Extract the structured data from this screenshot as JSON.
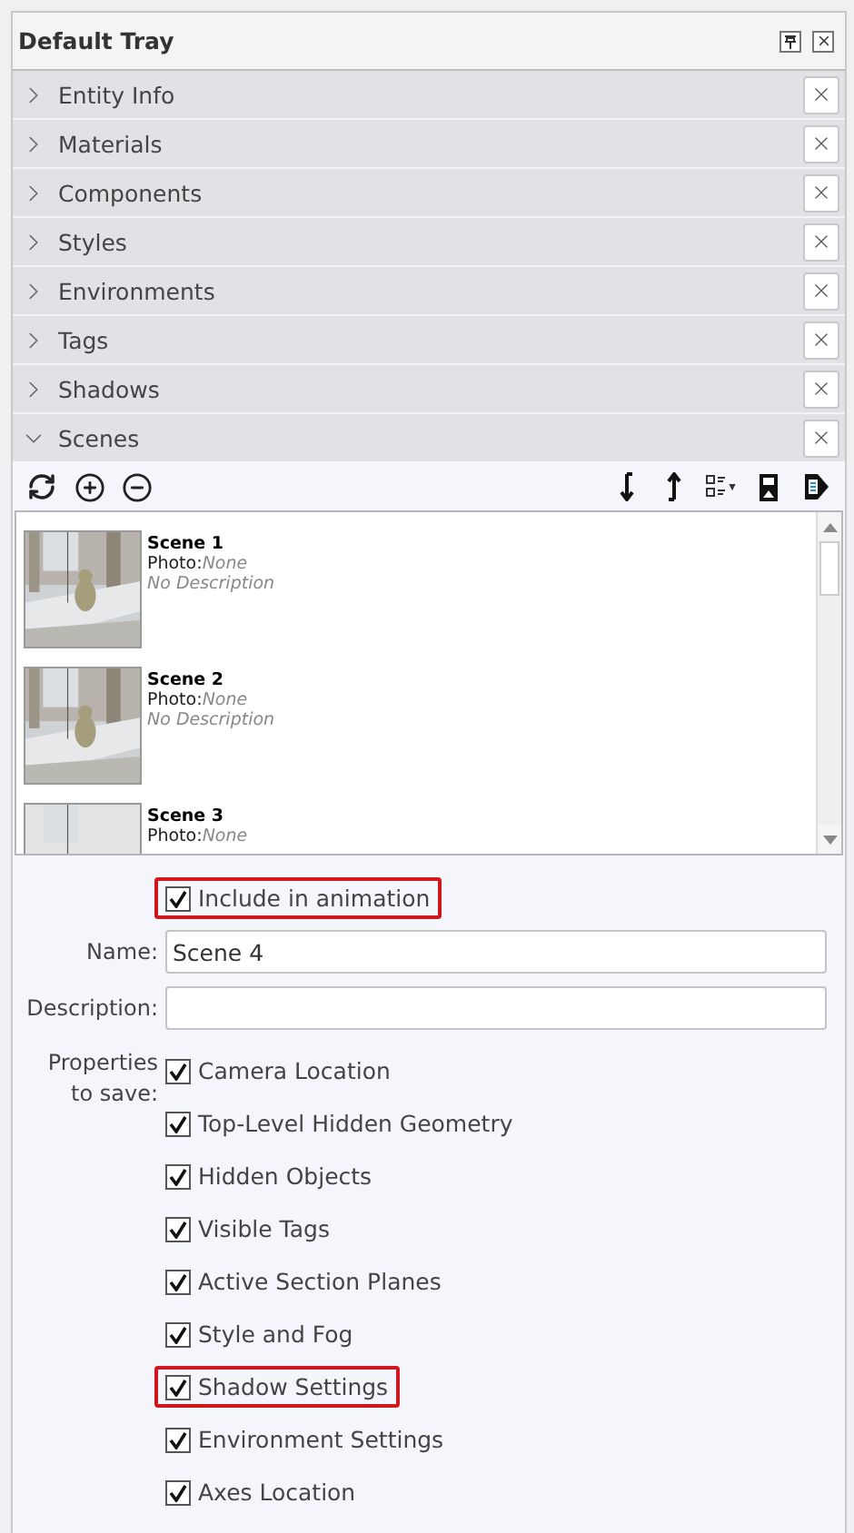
{
  "tray": {
    "title": "Default Tray"
  },
  "panels": [
    {
      "label": "Entity Info",
      "expanded": false
    },
    {
      "label": "Materials",
      "expanded": false
    },
    {
      "label": "Components",
      "expanded": false
    },
    {
      "label": "Styles",
      "expanded": false
    },
    {
      "label": "Environments",
      "expanded": false
    },
    {
      "label": "Tags",
      "expanded": false
    },
    {
      "label": "Shadows",
      "expanded": false
    },
    {
      "label": "Scenes",
      "expanded": true
    }
  ],
  "scenes": [
    {
      "name": "Scene 1",
      "photo_label": "Photo:",
      "photo": "None",
      "description": "No Description"
    },
    {
      "name": "Scene 2",
      "photo_label": "Photo:",
      "photo": "None",
      "description": "No Description"
    },
    {
      "name": "Scene 3",
      "photo_label": "Photo:",
      "photo": "None"
    }
  ],
  "include_animation": {
    "label": "Include in animation",
    "checked": true,
    "highlighted": true
  },
  "name_field": {
    "label": "Name:",
    "value": "Scene 4"
  },
  "description_field": {
    "label": "Description:"
  },
  "properties": {
    "label": "Properties\nto save:",
    "items": [
      {
        "label": "Camera Location",
        "checked": true,
        "highlighted": false
      },
      {
        "label": "Top-Level Hidden Geometry",
        "checked": true,
        "highlighted": false
      },
      {
        "label": "Hidden Objects",
        "checked": true,
        "highlighted": false
      },
      {
        "label": "Visible Tags",
        "checked": true,
        "highlighted": false
      },
      {
        "label": "Active Section Planes",
        "checked": true,
        "highlighted": false
      },
      {
        "label": "Style and Fog",
        "checked": true,
        "highlighted": false
      },
      {
        "label": "Shadow Settings",
        "checked": true,
        "highlighted": true
      },
      {
        "label": "Environment Settings",
        "checked": true,
        "highlighted": false
      },
      {
        "label": "Axes Location",
        "checked": true,
        "highlighted": false
      }
    ]
  }
}
